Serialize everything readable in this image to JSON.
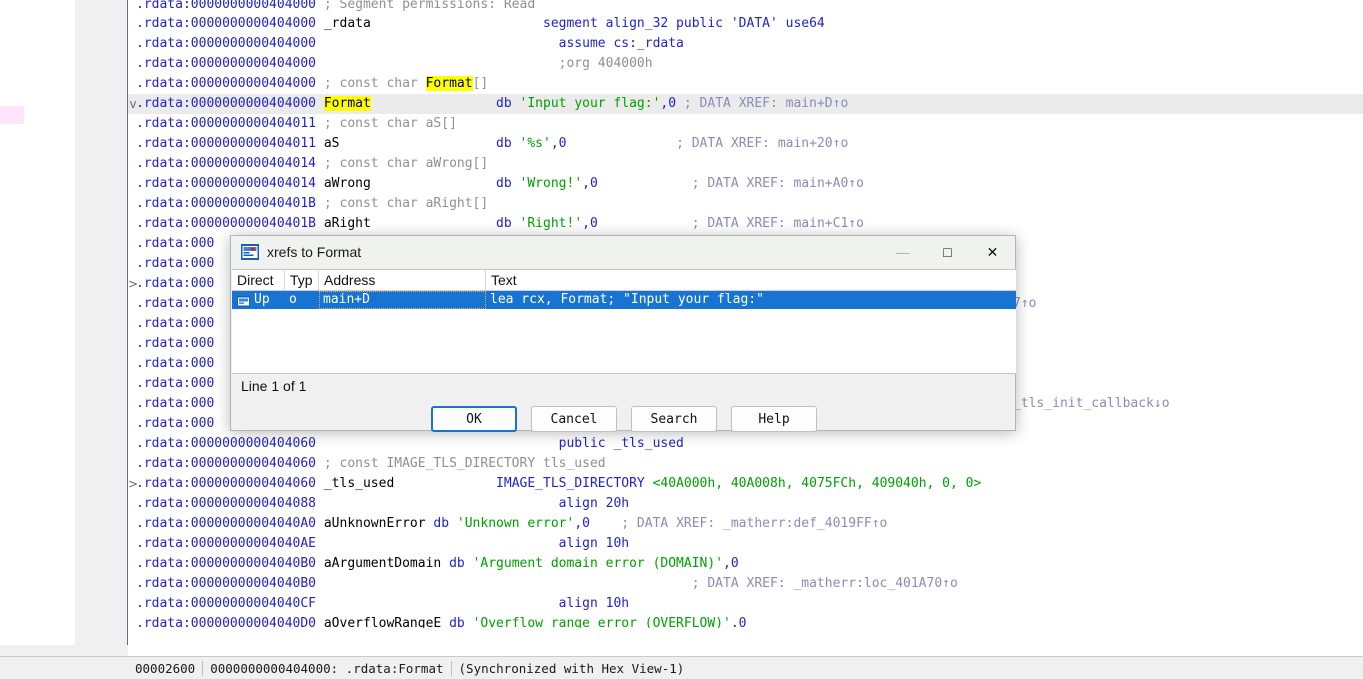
{
  "app": {
    "title": "IDA disassembly view"
  },
  "left_panel": {
    "navigator_marker": "navigator-band",
    "scrollbar": "vertical-scrollbar"
  },
  "disassembly": {
    "segment_prefix": ".rdata:",
    "lines": [
      {
        "addr": "0000000000404000",
        "arrow": "",
        "dot": false,
        "cut_top": true,
        "parts": [
          {
            "t": "gcmt",
            "v": "; Segment permissions: Read"
          }
        ],
        "indent": 2
      },
      {
        "addr": "0000000000404000",
        "arrow": "",
        "dot": false,
        "parts": [
          {
            "t": "name",
            "v": "_rdata"
          },
          {
            "t": "pad",
            "v": 22
          },
          {
            "t": "kw",
            "v": "segment align_32 public 'DATA' use64"
          }
        ]
      },
      {
        "addr": "0000000000404000",
        "arrow": "",
        "dot": false,
        "parts": [
          {
            "t": "pad",
            "v": 30
          },
          {
            "t": "kw",
            "v": "assume cs:_rdata"
          }
        ]
      },
      {
        "addr": "0000000000404000",
        "arrow": "",
        "dot": false,
        "parts": [
          {
            "t": "pad",
            "v": 30
          },
          {
            "t": "gcmt",
            "v": ";org 404000h"
          }
        ]
      },
      {
        "addr": "0000000000404000",
        "arrow": "",
        "dot": false,
        "parts": [
          {
            "t": "gcmt",
            "v": "; const char "
          },
          {
            "t": "hl",
            "v": "Format"
          },
          {
            "t": "gcmt",
            "v": "[]"
          }
        ],
        "indent": 2
      },
      {
        "addr": "0000000000404000",
        "arrow": "v",
        "dot": false,
        "current": true,
        "parts": [
          {
            "t": "hl",
            "v": "Format"
          },
          {
            "t": "pad",
            "v": 16
          },
          {
            "t": "kw",
            "v": "db "
          },
          {
            "t": "str",
            "v": "'Input your flag:'"
          },
          {
            "t": "num",
            "v": ",0"
          },
          {
            "t": "sp",
            "v": 1
          },
          {
            "t": "cmt",
            "v": "; DATA XREF: main+D↑o"
          }
        ]
      },
      {
        "addr": "0000000000404011",
        "arrow": "",
        "dot": true,
        "parts": [
          {
            "t": "gcmt",
            "v": "; const char aS[]"
          }
        ],
        "indent": 2
      },
      {
        "addr": "0000000000404011",
        "arrow": "",
        "dot": true,
        "parts": [
          {
            "t": "name",
            "v": "aS"
          },
          {
            "t": "pad",
            "v": 20
          },
          {
            "t": "kw",
            "v": "db "
          },
          {
            "t": "str",
            "v": "'%s'"
          },
          {
            "t": "num",
            "v": ",0"
          },
          {
            "t": "pad",
            "v": 14
          },
          {
            "t": "cmt",
            "v": "; DATA XREF: main+20↑o"
          }
        ]
      },
      {
        "addr": "0000000000404014",
        "arrow": "",
        "dot": true,
        "parts": [
          {
            "t": "gcmt",
            "v": "; const char aWrong[]"
          }
        ],
        "indent": 2
      },
      {
        "addr": "0000000000404014",
        "arrow": "",
        "dot": true,
        "parts": [
          {
            "t": "name",
            "v": "aWrong"
          },
          {
            "t": "pad",
            "v": 16
          },
          {
            "t": "kw",
            "v": "db "
          },
          {
            "t": "str",
            "v": "'Wrong!'"
          },
          {
            "t": "num",
            "v": ",0"
          },
          {
            "t": "pad",
            "v": 12
          },
          {
            "t": "cmt",
            "v": "; DATA XREF: main+A0↑o"
          }
        ]
      },
      {
        "addr": "000000000040401B",
        "arrow": "",
        "dot": true,
        "parts": [
          {
            "t": "gcmt",
            "v": "; const char aRight[]"
          }
        ],
        "indent": 2
      },
      {
        "addr": "000000000040401B",
        "arrow": "",
        "dot": true,
        "parts": [
          {
            "t": "name",
            "v": "aRight"
          },
          {
            "t": "pad",
            "v": 16
          },
          {
            "t": "kw",
            "v": "db "
          },
          {
            "t": "str",
            "v": "'Right!'"
          },
          {
            "t": "num",
            "v": ",0"
          },
          {
            "t": "pad",
            "v": 12
          },
          {
            "t": "cmt",
            "v": "; DATA XREF: main+C1↑o"
          }
        ]
      },
      {
        "addr": "000",
        "arrow": "",
        "dot": true,
        "occluded": true,
        "parts": []
      },
      {
        "addr": "000",
        "arrow": "",
        "dot": true,
        "occluded": true,
        "parts": []
      },
      {
        "addr": "000",
        "arrow": ">",
        "dot": true,
        "occluded": true,
        "parts": []
      },
      {
        "addr": "000",
        "arrow": "",
        "dot": true,
        "occluded": true,
        "tail": "7↑o",
        "parts": []
      },
      {
        "addr": "000",
        "arrow": "",
        "dot": true,
        "occluded": true,
        "parts": []
      },
      {
        "addr": "000",
        "arrow": "",
        "dot": true,
        "occluded": true,
        "parts": []
      },
      {
        "addr": "000",
        "arrow": "",
        "dot": true,
        "occluded": true,
        "parts": []
      },
      {
        "addr": "000",
        "arrow": "",
        "dot": true,
        "occluded": true,
        "parts": []
      },
      {
        "addr": "000",
        "arrow": "",
        "dot": true,
        "occluded": true,
        "tail": "_tls_init_callback↓o",
        "parts": []
      },
      {
        "addr": "000",
        "arrow": "",
        "dot": true,
        "occluded": true,
        "parts": []
      },
      {
        "addr": "0000000000404060",
        "arrow": "",
        "dot": false,
        "parts": [
          {
            "t": "pad",
            "v": 30
          },
          {
            "t": "kw",
            "v": "public _tls_used"
          }
        ]
      },
      {
        "addr": "0000000000404060",
        "arrow": "",
        "dot": false,
        "parts": [
          {
            "t": "gcmt",
            "v": "; const IMAGE_TLS_DIRECTORY tls_used"
          }
        ],
        "indent": 2
      },
      {
        "addr": "0000000000404060",
        "arrow": ">",
        "dot": false,
        "parts": [
          {
            "t": "name",
            "v": "_tls_used"
          },
          {
            "t": "pad",
            "v": 13
          },
          {
            "t": "kw",
            "v": "IMAGE_TLS_DIRECTORY "
          },
          {
            "t": "str",
            "v": "<40A000h, 40A008h, 4075FCh, 409040h, 0, 0>"
          }
        ]
      },
      {
        "addr": "0000000000404088",
        "arrow": "",
        "dot": false,
        "parts": [
          {
            "t": "pad",
            "v": 30
          },
          {
            "t": "kw",
            "v": "align 20h"
          }
        ]
      },
      {
        "addr": "00000000004040A0",
        "arrow": "",
        "dot": true,
        "parts": [
          {
            "t": "name",
            "v": "aUnknownError"
          },
          {
            "t": "sp",
            "v": 1
          },
          {
            "t": "kw",
            "v": "db "
          },
          {
            "t": "str",
            "v": "'Unknown error'"
          },
          {
            "t": "num",
            "v": ",0"
          },
          {
            "t": "pad",
            "v": 4
          },
          {
            "t": "cmt",
            "v": "; DATA XREF: _matherr:def_4019FF↑o"
          }
        ]
      },
      {
        "addr": "00000000004040AE",
        "arrow": "",
        "dot": true,
        "parts": [
          {
            "t": "pad",
            "v": 30
          },
          {
            "t": "kw",
            "v": "align 10h"
          }
        ]
      },
      {
        "addr": "00000000004040B0",
        "arrow": "",
        "dot": true,
        "parts": [
          {
            "t": "name",
            "v": "aArgumentDomain"
          },
          {
            "t": "sp",
            "v": 1
          },
          {
            "t": "kw",
            "v": "db "
          },
          {
            "t": "str",
            "v": "'Argument domain error (DOMAIN)'"
          },
          {
            "t": "num",
            "v": ",0"
          }
        ]
      },
      {
        "addr": "00000000004040B0",
        "arrow": "",
        "dot": true,
        "parts": [
          {
            "t": "pad",
            "v": 47
          },
          {
            "t": "cmt",
            "v": "; DATA XREF: _matherr:loc_401A70↑o"
          }
        ]
      },
      {
        "addr": "00000000004040CF",
        "arrow": "",
        "dot": true,
        "parts": [
          {
            "t": "pad",
            "v": 30
          },
          {
            "t": "kw",
            "v": "align 10h"
          }
        ]
      },
      {
        "addr": "00000000004040D0",
        "arrow": "",
        "dot": true,
        "cut_bottom": true,
        "parts": [
          {
            "t": "name",
            "v": "aOverflowRangeE"
          },
          {
            "t": "sp",
            "v": 1
          },
          {
            "t": "kw",
            "v": "db "
          },
          {
            "t": "str",
            "v": "'Overflow range error (OVERFLOW)'"
          },
          {
            "t": "num",
            "v": ".0"
          }
        ]
      }
    ]
  },
  "dialog": {
    "title": "xrefs to Format",
    "icon": "ida-xrefs-icon",
    "window_controls": {
      "minimize": "—",
      "maximize": "□",
      "close": "✕"
    },
    "columns": [
      "Direct",
      "Typ",
      "Address",
      "Text"
    ],
    "rows": [
      {
        "icon": "xref-row-icon",
        "direction": "Up",
        "type": "o",
        "address": "main+D",
        "text": "lea     rcx, Format; \"Input your flag:\""
      }
    ],
    "status": "Line 1 of 1",
    "buttons": [
      {
        "label": "OK",
        "focused": true
      },
      {
        "label": "Cancel",
        "focused": false
      },
      {
        "label": "Search",
        "focused": false
      },
      {
        "label": "Help",
        "focused": false
      }
    ]
  },
  "statusbar": {
    "offset": "00002600",
    "address": "0000000000404000: .rdata:Format",
    "sync": "(Synchronized with Hex View-1)"
  },
  "colors": {
    "address": "#2222cc",
    "string": "#00a000",
    "comment": "#8b8bb8",
    "highlight": "#ffff00",
    "selection": "#1874d2",
    "dot": "#49c3f0"
  }
}
